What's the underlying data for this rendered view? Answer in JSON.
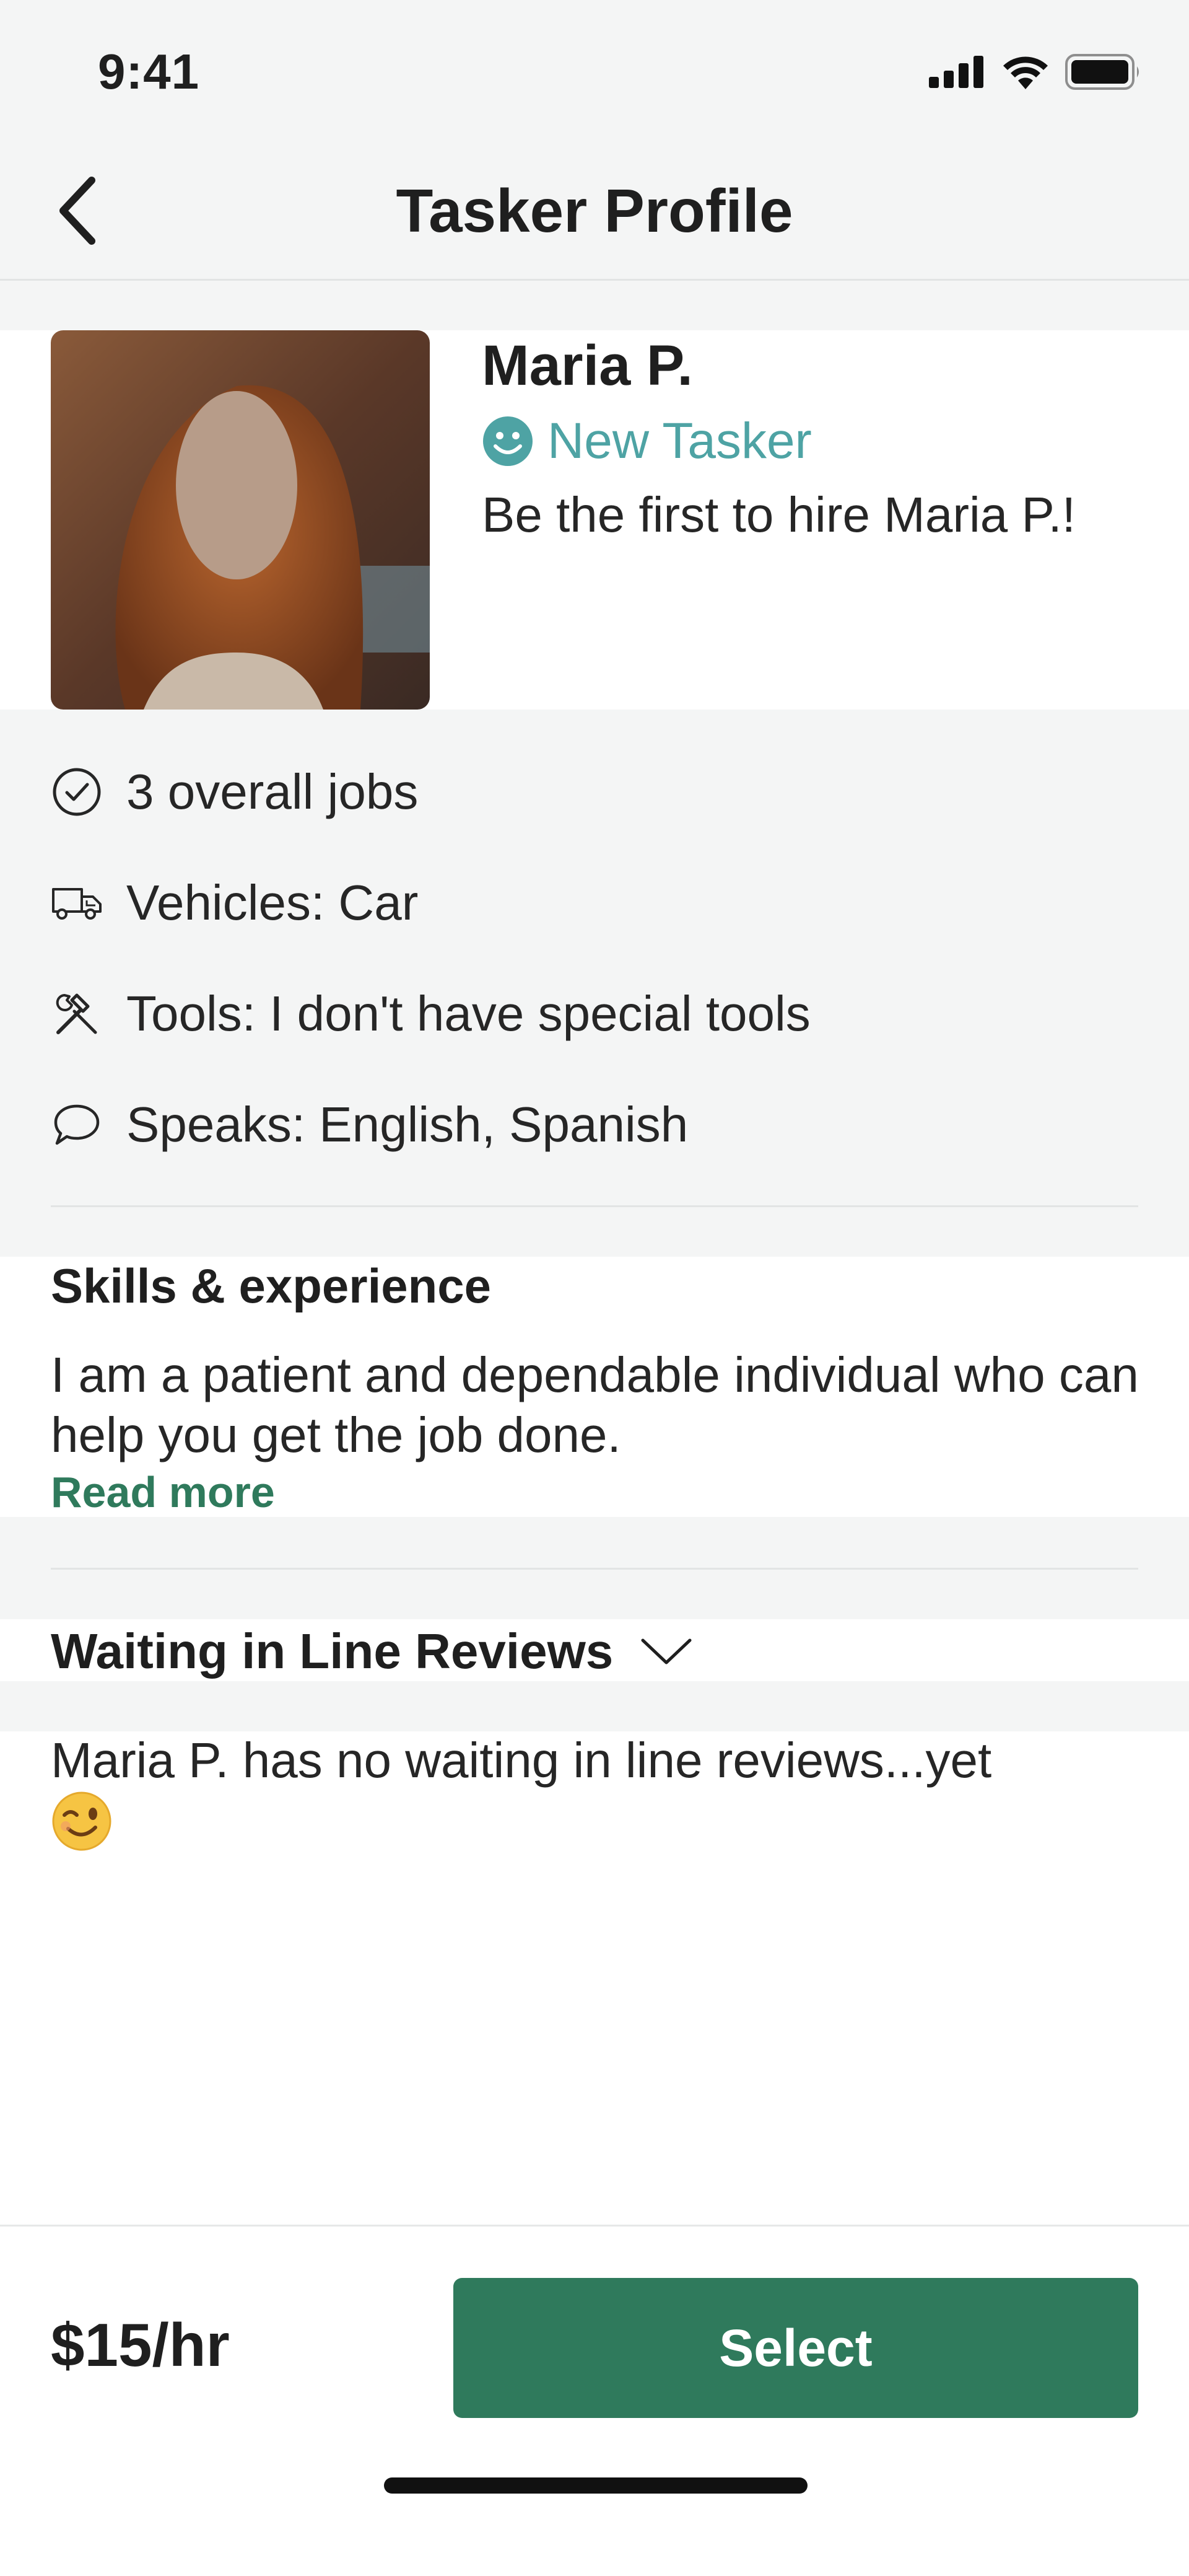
{
  "status_bar": {
    "time": "9:41",
    "icons": [
      "cellular-signal-icon",
      "wifi-icon",
      "battery-icon"
    ]
  },
  "header": {
    "title": "Tasker Profile",
    "back_icon": "chevron-left-icon"
  },
  "profile": {
    "name": "Maria P.",
    "badge_label": "New Tasker",
    "badge_icon": "smiley-icon",
    "hire_prompt": "Be the first to hire Maria P.!",
    "avatar_icon": "profile-photo"
  },
  "facts": [
    {
      "icon": "check-circle-icon",
      "text": "3 overall jobs"
    },
    {
      "icon": "truck-icon",
      "text": "Vehicles: Car"
    },
    {
      "icon": "tools-icon",
      "text": "Tools: I don't have special tools"
    },
    {
      "icon": "speech-bubble-icon",
      "text": "Speaks: English, Spanish"
    }
  ],
  "skills": {
    "heading": "Skills & experience",
    "text": "I am a patient and dependable individual who can help you get the job done.",
    "read_more": "Read more"
  },
  "reviews": {
    "heading": "Waiting in Line Reviews",
    "toggle_icon": "chevron-down-icon",
    "empty_text": "Maria P. has no waiting in line reviews...yet",
    "emoji_icon": "winking-face-icon"
  },
  "footer": {
    "price": "$15/hr",
    "select_label": "Select"
  },
  "colors": {
    "accent_green": "#2f7a5c",
    "badge_teal": "#4ea3a4",
    "background_grey": "#f4f5f5"
  }
}
